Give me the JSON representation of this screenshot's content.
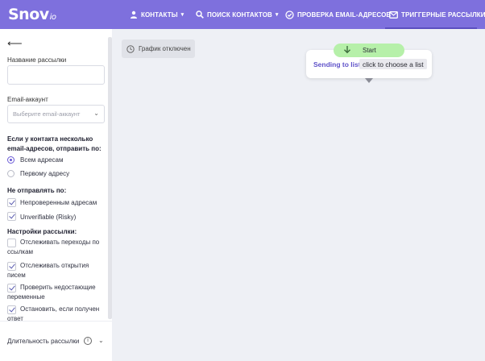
{
  "brand": {
    "logo_main": "Snov",
    "logo_suffix": "io"
  },
  "nav": {
    "items": [
      {
        "label": "КОНТАКТЫ",
        "icon": "person-icon",
        "has_dropdown": true
      },
      {
        "label": "ПОИСК КОНТАКТОВ",
        "icon": "search-icon",
        "has_dropdown": true
      },
      {
        "label": "ПРОВЕРКА EMAIL-АДРЕСОВ",
        "icon": "check-circle-icon",
        "has_dropdown": false
      },
      {
        "label": "ТРИГГЕРНЫЕ РАССЫЛКИ",
        "icon": "envelope-icon",
        "has_dropdown": false,
        "active": true
      }
    ]
  },
  "sidebar": {
    "back_icon": "arrow-left-icon",
    "campaign_name_label": "Название рассылки",
    "campaign_name_value": "",
    "email_account_label": "Email-аккаунт",
    "email_account_placeholder": "Выберите email-аккаунт",
    "multiple_emails_heading": "Если у контакта несколько email-адресов, отправить по:",
    "send_options": [
      {
        "label": "Всем адресам",
        "selected": true
      },
      {
        "label": "Первому адресу",
        "selected": false
      }
    ],
    "do_not_send_heading": "Не отправлять по:",
    "do_not_send_options": [
      {
        "label": "Непроверенным адресам",
        "checked": true
      },
      {
        "label": "Unverifiable (Risky)",
        "checked": true
      }
    ],
    "settings_heading": "Настройки рассылки:",
    "settings_options": [
      {
        "label": "Отслеживать переходы по ссылкам",
        "checked": false
      },
      {
        "label": "Отслеживать открытия писем",
        "checked": true
      },
      {
        "label": "Проверить недостающие переменные",
        "checked": true
      },
      {
        "label": "Остановить, если получен ответ",
        "checked": true
      }
    ],
    "duration_label": "Длительность рассылки",
    "duration_info_icon": "info-icon",
    "duration_chevron_icon": "chevron-down-icon"
  },
  "canvas": {
    "graph_status": "График отключен",
    "graph_status_icon": "clock-icon",
    "start_label": "Start",
    "start_icon": "arrow-down-icon",
    "node_action": "Sending to list",
    "node_placeholder": "click to choose a list"
  },
  "colors": {
    "header": "#7e70dd",
    "accent": "#5f52c9",
    "start_pill": "#b6f0a9",
    "canvas_bg": "#eef0f5"
  }
}
